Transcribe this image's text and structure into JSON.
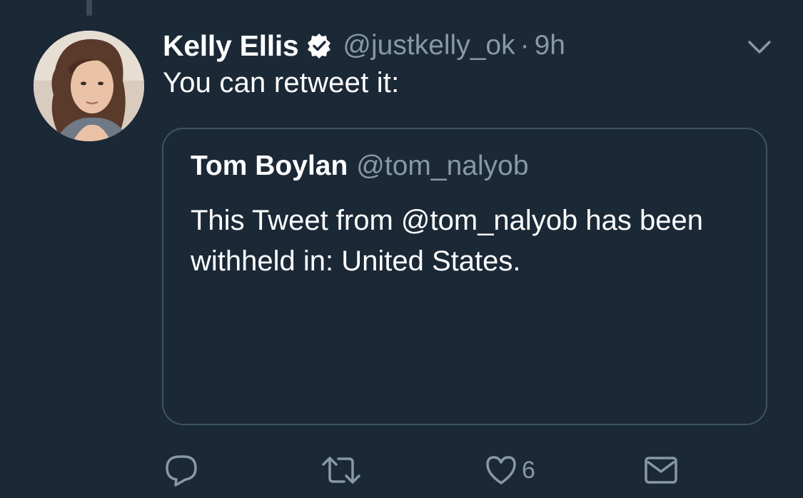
{
  "tweet": {
    "author": {
      "display_name": "Kelly Ellis",
      "handle": "@justkelly_ok",
      "verified": true,
      "avatar_icon": "profile-photo"
    },
    "separator": "·",
    "time": "9h",
    "text": "You can retweet it:",
    "menu_icon": "chevron-down-icon"
  },
  "quoted_tweet": {
    "display_name": "Tom Boylan",
    "handle": "@tom_nalyob",
    "text": "This Tweet from @tom_nalyob has been withheld in: United States."
  },
  "actions": {
    "reply_icon": "reply-icon",
    "retweet_icon": "retweet-icon",
    "like_icon": "heart-icon",
    "like_count": "6",
    "message_icon": "envelope-icon"
  },
  "colors": {
    "background": "#1b2836",
    "primary_text": "#ffffff",
    "secondary_text": "#8899a6",
    "border": "#3d5466"
  }
}
